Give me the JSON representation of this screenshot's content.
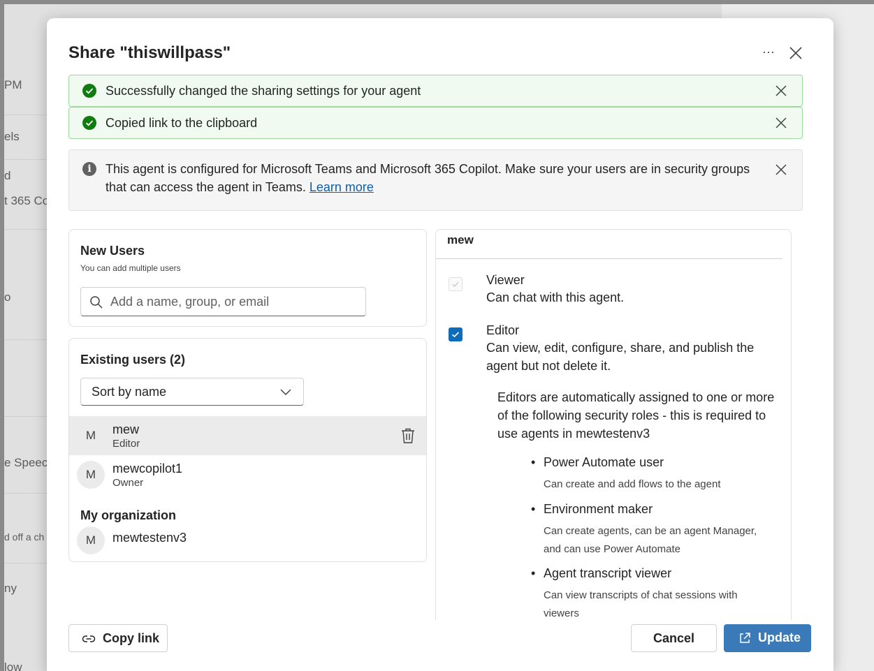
{
  "background": {
    "items": [
      "PM",
      "els",
      "d",
      "t 365 Co",
      "o",
      "e Speec",
      "d off a ch",
      "ny",
      "low"
    ]
  },
  "dialog": {
    "title": "Share \"thiswillpass\"",
    "more_label": "···"
  },
  "notifications": [
    {
      "type": "success",
      "text": "Successfully changed the sharing settings for your agent"
    },
    {
      "type": "success",
      "text": "Copied link to the clipboard"
    }
  ],
  "info": {
    "text_line1": "This agent is configured for Microsoft Teams and Microsoft 365 Copilot. Make sure your users are in security groups",
    "text_line2": "that can access the agent in Teams.",
    "link": "Learn more",
    "icon": "i"
  },
  "new_users": {
    "title": "New Users",
    "subtitle": "You can add multiple users",
    "search_placeholder": "Add a name, group, or email"
  },
  "existing_users": {
    "title": "Existing users (2)",
    "sort_label": "Sort by name",
    "users": [
      {
        "initial": "M",
        "name": "mew",
        "role": "Editor"
      },
      {
        "initial": "M",
        "name": "mewcopilot1",
        "role": "Owner"
      }
    ],
    "org_title": "My organization",
    "org": {
      "initial": "M",
      "name": "mewtestenv3"
    }
  },
  "permissions": {
    "user": "mew",
    "roles": [
      {
        "name": "Viewer",
        "desc": "Can chat with this agent.",
        "checked": true,
        "disabled": true
      },
      {
        "name": "Editor",
        "desc": "Can view, edit, configure, share, and publish the agent but not delete it.",
        "checked": true,
        "disabled": false
      }
    ],
    "note": "Editors are automatically assigned to one or more of the following security roles - this is required to use agents in mewtestenv3",
    "security_roles": [
      {
        "title": "Power Automate user",
        "desc": "Can create and add flows to the agent"
      },
      {
        "title": "Environment maker",
        "desc": "Can create agents, can be an agent Manager, and can use Power Automate"
      },
      {
        "title": "Agent transcript viewer",
        "desc": "Can view transcripts of chat sessions with viewers"
      }
    ]
  },
  "footer": {
    "copy_link": "Copy link",
    "cancel": "Cancel",
    "update": "Update"
  },
  "colors": {
    "accent": "#0f6cbd",
    "primary_button": "#3b7ab8",
    "success_bg": "#f1faf1",
    "success_border": "#9fd89f",
    "success_icon": "#107c10",
    "info_bg": "#f5f5f5"
  }
}
